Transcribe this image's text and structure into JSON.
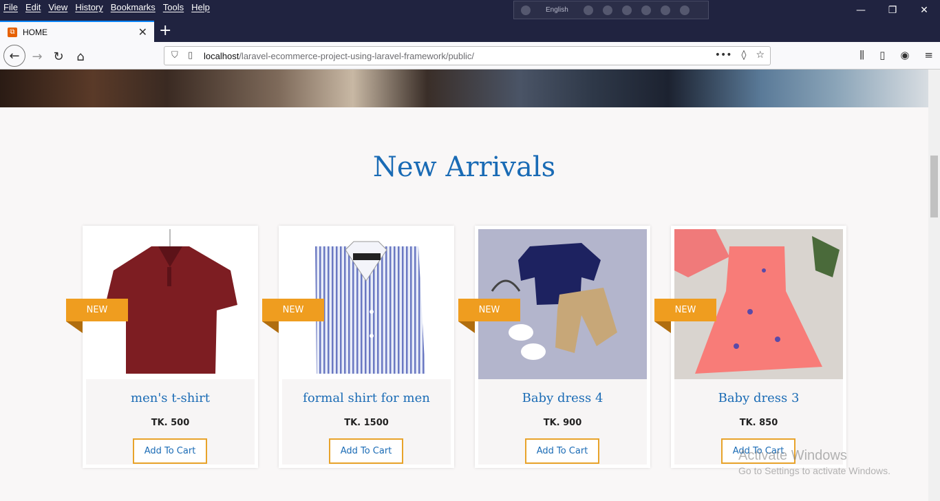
{
  "menu": [
    "File",
    "Edit",
    "View",
    "History",
    "Bookmarks",
    "Tools",
    "Help"
  ],
  "extension_bar": {
    "language": "English"
  },
  "window_controls": {
    "minimize": "—",
    "restore": "❐",
    "close": "✕"
  },
  "tab": {
    "title": "HOME",
    "close": "✕",
    "new_tab": "+"
  },
  "nav": {
    "url_host": "localhost",
    "url_path": "/laravel-ecommerce-project-using-laravel-framework/public/",
    "back": "←",
    "forward": "→",
    "reload": "↻",
    "home": "⌂",
    "page_actions": "•••",
    "pocket": "◊",
    "bookmark_star": "☆",
    "library": "⫼",
    "sidebar": "▯",
    "account": "◉",
    "hamburger": "≡"
  },
  "section_title": "New Arrivals",
  "products": [
    {
      "badge": "NEW",
      "name": "men's t-shirt",
      "price": "TK. 500",
      "cart_label": "Add To Cart"
    },
    {
      "badge": "NEW",
      "name": "formal shirt for men",
      "price": "TK. 1500",
      "cart_label": "Add To Cart"
    },
    {
      "badge": "NEW",
      "name": "Baby dress 4",
      "price": "TK. 900",
      "cart_label": "Add To Cart"
    },
    {
      "badge": "NEW",
      "name": "Baby dress 3",
      "price": "TK. 850",
      "cart_label": "Add To Cart"
    }
  ],
  "watermark": {
    "line1": "Activate Windows",
    "line2": "Go to Settings to activate Windows."
  },
  "colors": {
    "accent": "#1a6bb5",
    "badge": "#ef9d1f",
    "cart_border": "#e8a32a",
    "titlebar": "#202340"
  }
}
